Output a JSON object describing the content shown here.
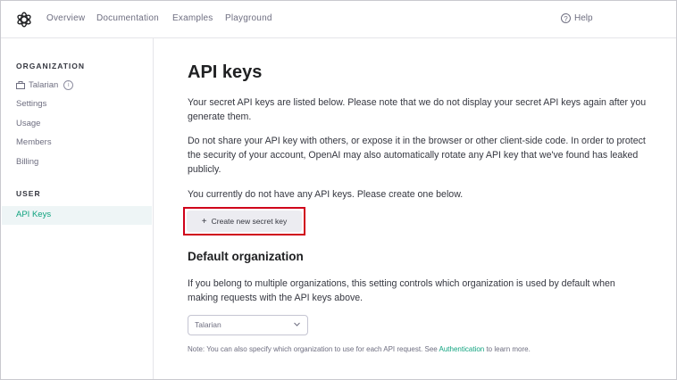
{
  "topnav": {
    "items": [
      "Overview",
      "Documentation",
      "Examples",
      "Playground"
    ],
    "help_label": "Help"
  },
  "sidebar": {
    "org_heading": "ORGANIZATION",
    "org_name": "Talarian",
    "items": [
      "Settings",
      "Usage",
      "Members",
      "Billing"
    ],
    "user_heading": "USER",
    "active_item": "API Keys"
  },
  "main": {
    "title": "API keys",
    "paragraph1": "Your secret API keys are listed below. Please note that we do not display your secret API keys again after you generate them.",
    "paragraph2": "Do not share your API key with others, or expose it in the browser or other client-side code. In order to protect the security of your account, OpenAI may also automatically rotate any API key that we've found has leaked publicly.",
    "paragraph3": "You currently do not have any API keys. Please create one below.",
    "create_button": "Create new secret key",
    "default_org_title": "Default organization",
    "paragraph4": "If you belong to multiple organizations, this setting controls which organization is used by default when making requests with the API keys above.",
    "select_value": "Talarian",
    "note_prefix": "Note: You can also specify which organization to use for each API request. See",
    "note_link": "Authentication",
    "note_suffix": "to learn more."
  },
  "colors": {
    "accent": "#10a37f",
    "highlight_border": "#d0021b"
  }
}
